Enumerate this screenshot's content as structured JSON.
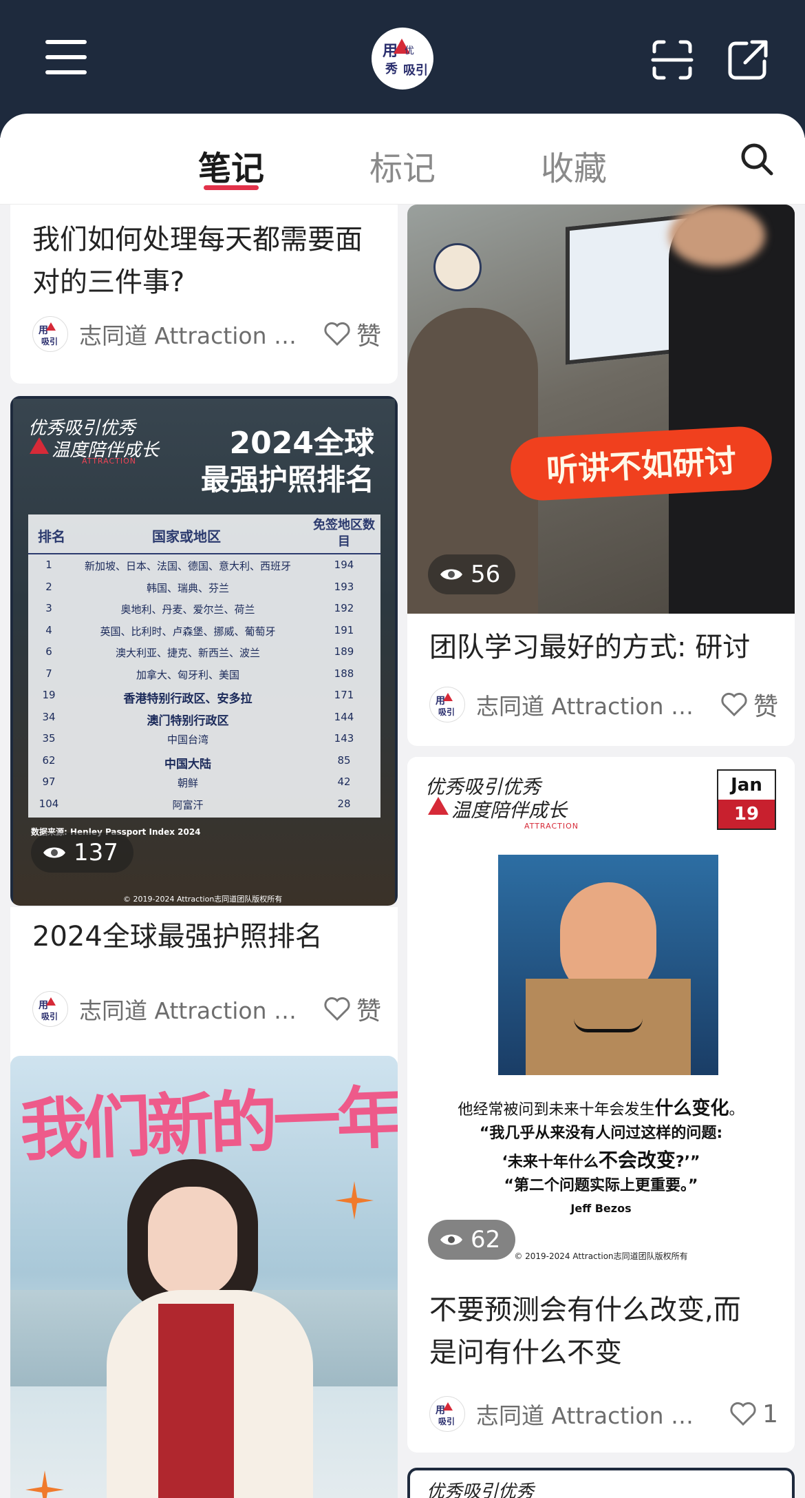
{
  "header": {
    "menu_icon": "hamburger-menu-icon",
    "logo_text": "吸引优秀",
    "scan_icon": "scan-icon",
    "share_icon": "share-icon"
  },
  "tabs": [
    {
      "label": "笔记",
      "active": true
    },
    {
      "label": "标记",
      "active": false
    },
    {
      "label": "收藏",
      "active": false
    }
  ],
  "search_icon": "search-icon",
  "colors": {
    "header_bg": "#1e2a3d",
    "accent": "#e2324a"
  },
  "feed": {
    "left": [
      {
        "title": "我们如何处理每天都需要面对的三件事?",
        "author": "志同道 Attraction 温度",
        "like_label": "赞"
      },
      {
        "title": "2024全球最强护照排名",
        "views": "137",
        "author": "志同道 Attraction 温度",
        "like_label": "赞",
        "image": {
          "brand_line1": "优秀吸引优秀",
          "brand_line2": "温度陪伴成长",
          "brand_sub": "ATTRACTION",
          "headline1": "2024全球",
          "headline2": "最强护照排名",
          "table_headers": [
            "排名",
            "国家或地区",
            "免签地区数目"
          ],
          "rows": [
            [
              "1",
              "新加坡、日本、法国、德国、意大利、西班牙",
              "194"
            ],
            [
              "2",
              "韩国、瑞典、芬兰",
              "193"
            ],
            [
              "3",
              "奥地利、丹麦、爱尔兰、荷兰",
              "192"
            ],
            [
              "4",
              "英国、比利时、卢森堡、挪威、葡萄牙",
              "191"
            ],
            [
              "6",
              "澳大利亚、捷克、新西兰、波兰",
              "189"
            ],
            [
              "7",
              "加拿大、匈牙利、美国",
              "188"
            ],
            [
              "19",
              "香港特别行政区、安多拉",
              "171"
            ],
            [
              "34",
              "澳门特别行政区",
              "144"
            ],
            [
              "35",
              "中国台湾",
              "143"
            ],
            [
              "62",
              "中国大陆",
              "85"
            ],
            [
              "97",
              "朝鲜",
              "42"
            ],
            [
              "104",
              "阿富汗",
              "28"
            ]
          ],
          "source": "数据来源: Henley Passport Index 2024",
          "copyright": "© 2019-2024 Attraction志同道团队版权所有"
        }
      },
      {
        "image": {
          "poster_text": "我们新的一年"
        }
      }
    ],
    "right": [
      {
        "title": "团队学习最好的方式: 研讨",
        "views": "56",
        "author": "志同道 Attraction 温度",
        "like_label": "赞",
        "image": {
          "caption": "听讲不如研讨"
        }
      },
      {
        "title": "不要预测会有什么改变,而是问有什么不变",
        "views": "62",
        "author": "志同道 Attraction 温度",
        "like_count": "1",
        "image": {
          "brand_line1": "优秀吸引优秀",
          "brand_line2": "温度陪伴成长",
          "brand_sub": "ATTRACTION",
          "date_month": "Jan",
          "date_day": "19",
          "quote1_a": "他经常被问到未来十年会发生",
          "quote1_b": "什么变化",
          "quote1_c": "。",
          "quote2": "“我几乎从来没有人问过这样的问题:",
          "quote3_a": "‘未来十年什么",
          "quote3_b": "不会改变",
          "quote3_c": "?’”",
          "quote4": "“第二个问题实际上更重要。”",
          "quote_author": "Jeff Bezos",
          "copyright": "© 2019-2024 Attraction志同道团队版权所有"
        }
      },
      {
        "image": {
          "partial_text": "优秀吸引优秀"
        }
      }
    ]
  }
}
